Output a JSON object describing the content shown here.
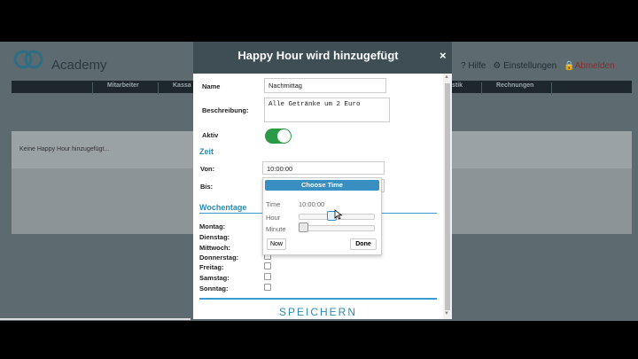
{
  "background": {
    "app_name": "Academy",
    "top_links": {
      "help": "? Hilfe",
      "settings": "Einstellungen",
      "logout": "Abmelden"
    },
    "nav": [
      "Mitarbeiter",
      "Kassa",
      "stik",
      "Rechnungen"
    ],
    "panel_text": "Keine Happy Hour hinzugefügt..."
  },
  "modal": {
    "title": "Happy Hour wird hinzugefügt",
    "close": "×",
    "name_label": "Name",
    "name_value": "Nachmittag",
    "desc_label": "Beschreibung:",
    "desc_value": "Alle Getränke um 2 Euro",
    "active_label": "Aktiv",
    "active_on": true,
    "time_section": "Zeit",
    "from_label": "Von:",
    "from_value": "10:00:00",
    "to_label": "Bis:",
    "weekdays_section": "Wochentage",
    "weekdays": [
      "Montag:",
      "Dienstag:",
      "Mittwoch:",
      "Donnerstag:",
      "Freitag:",
      "Samstag:",
      "Sonntag:"
    ],
    "save_label": "SPEICHERN"
  },
  "time_picker": {
    "title": "Choose Time",
    "time_label": "Time",
    "time_value": "10:00:00",
    "hour_label": "Hour",
    "minute_label": "Minute",
    "hour_fraction": 0.42,
    "minute_fraction": 0.0,
    "now_label": "Now",
    "done_label": "Done"
  },
  "colors": {
    "accent": "#2a8ab1",
    "toggle_on": "#2b9a46",
    "picker_header": "#3a8fc2",
    "modal_header": "#3e4e54"
  }
}
